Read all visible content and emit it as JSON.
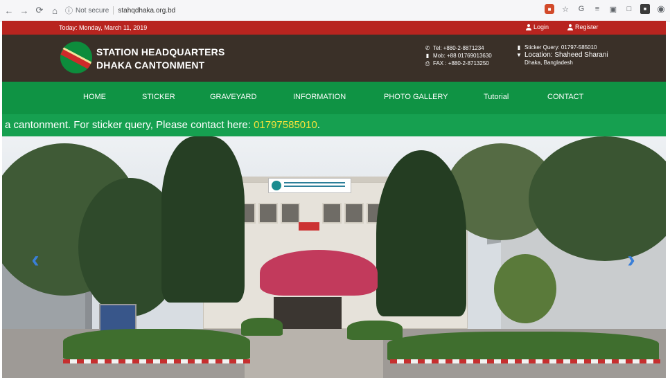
{
  "browser": {
    "security_label": "Not secure",
    "url": "stahqdhaka.org.bd"
  },
  "topbar": {
    "date": "Today: Monday, March 11, 2019",
    "login": "Login",
    "register": "Register"
  },
  "brand": {
    "line1": "STATION HEADQUARTERS",
    "line2": "DHAKA CANTONMENT"
  },
  "contacts": {
    "tel": "Tel: +880-2-8871234",
    "mob": "Mob: +88 01769013630",
    "fax": "FAX : +880-2-8713250",
    "sticker_query": "Sticker Query: 01797-585010",
    "location": "Location: Shaheed Sharani",
    "city": "Dhaka, Bangladesh"
  },
  "nav": {
    "items": [
      {
        "label": "HOME"
      },
      {
        "label": "STICKER"
      },
      {
        "label": "GRAVEYARD"
      },
      {
        "label": "INFORMATION"
      },
      {
        "label": "PHOTO GALLERY"
      },
      {
        "label": "Tutorial"
      },
      {
        "label": "CONTACT"
      }
    ]
  },
  "ticker": {
    "text": "a cantonment. For sticker query, Please contact here: ",
    "phone": "01797585010",
    "suffix": "."
  },
  "colors": {
    "topbar_red": "#b8241f",
    "header_brown": "#3a3028",
    "nav_green": "#0f9344",
    "ticker_green": "#16a050",
    "ticker_phone": "#f6e23a",
    "carousel_arrow": "#3a7fd8"
  },
  "carousel": {
    "prev_icon": "chevron-left-icon",
    "next_icon": "chevron-right-icon",
    "prev_glyph": "‹",
    "next_glyph": "›"
  }
}
